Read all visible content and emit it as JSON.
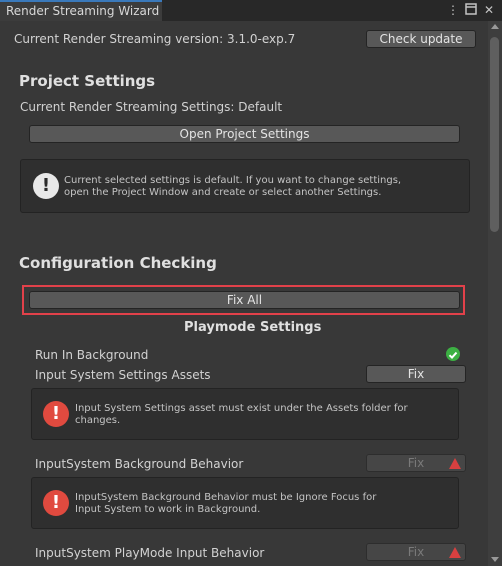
{
  "window": {
    "title": "Render Streaming Wizard"
  },
  "header": {
    "version_text": "Current Render Streaming version: 3.1.0-exp.7",
    "check_update_label": "Check update"
  },
  "project_settings": {
    "heading": "Project Settings",
    "current_text": "Current Render Streaming Settings: Default",
    "open_button_label": "Open Project Settings",
    "info_text": "Current selected settings is default. If you want to change settings, open the Project Window and create or select another Settings."
  },
  "configuration": {
    "heading": "Configuration Checking",
    "fix_all_label": "Fix All",
    "playmode_heading": "Playmode Settings",
    "items": [
      {
        "label": "Run In Background",
        "status": "ok"
      },
      {
        "label": "Input System Settings Assets",
        "fix_label": "Fix",
        "error": "Input System Settings asset must exist under the Assets folder for changes."
      },
      {
        "label": "InputSystem Background Behavior",
        "fix_label": "Fix",
        "error": "InputSystem Background Behavior must be Ignore Focus for Input System to work in Background."
      },
      {
        "label": "InputSystem PlayMode Input Behavior",
        "fix_label": "Fix"
      }
    ]
  },
  "colors": {
    "highlight": "#e2414a",
    "error": "#e04a3f",
    "ok": "#3cb043",
    "tab_accent": "#3a79bb"
  },
  "icons": {
    "menu": "kebab-menu-icon",
    "maximize": "maximize-icon",
    "close": "close-icon",
    "info": "info-icon",
    "error": "error-icon",
    "check": "check-icon",
    "warning": "warning-icon"
  }
}
